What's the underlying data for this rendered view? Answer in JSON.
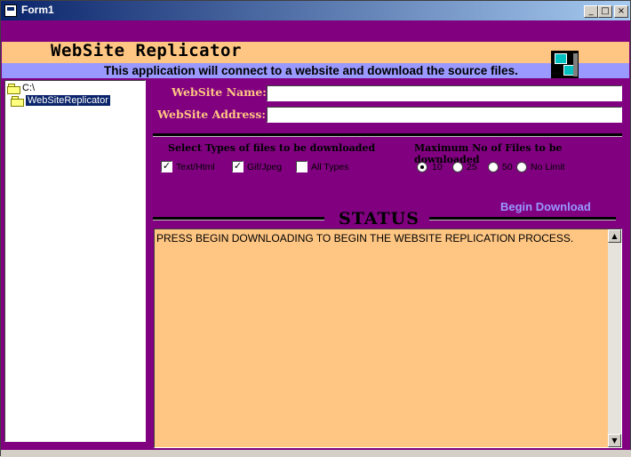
{
  "window": {
    "title": "Form1",
    "controls": {
      "minimize": "_",
      "maximize": "□",
      "close": "×"
    }
  },
  "banner": {
    "title": "WebSite Replicator",
    "subtitle": "This application will connect to a website and download the source files.",
    "icon": "computer-network-icon"
  },
  "tree": {
    "items": [
      {
        "label": "C:\\",
        "icon": "folder-icon",
        "selected": false
      },
      {
        "label": "WebSiteReplicator",
        "icon": "folder-open-icon",
        "selected": true
      }
    ]
  },
  "form": {
    "name_label": "WebSite Name:",
    "name_value": "",
    "address_label": "WebSite Address:",
    "address_value": ""
  },
  "file_types": {
    "heading": "Select Types of files to be downloaded",
    "options": [
      {
        "label": "Text/Html",
        "checked": true
      },
      {
        "label": "Gif/Jpeg",
        "checked": true
      },
      {
        "label": "All Types",
        "checked": false
      }
    ]
  },
  "max_files": {
    "heading": "Maximum No of Files to be downloaded",
    "options": [
      {
        "label": "10",
        "selected": true
      },
      {
        "label": "25",
        "selected": false
      },
      {
        "label": "50",
        "selected": false
      },
      {
        "label": "No Limit",
        "selected": false
      }
    ]
  },
  "actions": {
    "begin_download": "Begin Download"
  },
  "status": {
    "title": "STATUS",
    "text": "PRESS BEGIN DOWNLOADING TO BEGIN THE WEBSITE REPLICATION PROCESS."
  },
  "colors": {
    "background": "#800080",
    "banner": "#ffc683",
    "subtitle_bar": "#9999ff",
    "label": "#ffc683",
    "link": "#9999ff"
  }
}
